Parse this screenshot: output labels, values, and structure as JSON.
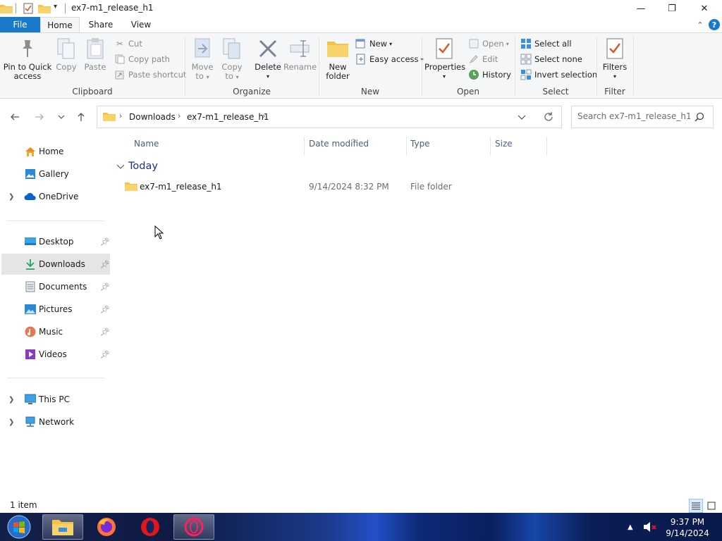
{
  "window": {
    "title": "ex7-m1_release_h1",
    "controls": {
      "minimize": "—",
      "restore": "❐",
      "close": "✕"
    }
  },
  "ribbon_tabs": [
    {
      "label": "File",
      "selected": false
    },
    {
      "label": "Home",
      "selected": true
    },
    {
      "label": "Share",
      "selected": false
    },
    {
      "label": "View",
      "selected": false
    }
  ],
  "ribbon": {
    "clipboard": {
      "label": "Clipboard",
      "pin": "Pin to Quick access",
      "pin_line1": "Pin to Quick",
      "pin_line2": "access",
      "copy": "Copy",
      "paste": "Paste",
      "cut": "Cut",
      "copy_path": "Copy path",
      "paste_shortcut": "Paste shortcut"
    },
    "organize": {
      "label": "Organize",
      "move_line1": "Move",
      "move_line2": "to",
      "copy_line1": "Copy",
      "copy_line2": "to",
      "delete": "Delete",
      "rename": "Rename"
    },
    "new": {
      "label": "New",
      "new_folder_line1": "New",
      "new_folder_line2": "folder",
      "new_item": "New",
      "easy_access": "Easy access"
    },
    "open": {
      "label": "Open",
      "properties": "Properties",
      "open": "Open",
      "edit": "Edit",
      "history": "History"
    },
    "select": {
      "label": "Select",
      "select_all": "Select all",
      "select_none": "Select none",
      "invert_selection": "Invert selection"
    },
    "filter": {
      "label": "Filter",
      "filters": "Filters"
    }
  },
  "address_bar": {
    "crumbs": [
      "Downloads",
      "ex7-m1_release_h1"
    ]
  },
  "search": {
    "placeholder": "Search ex7-m1_release_h1"
  },
  "nav_pane": {
    "home": "Home",
    "gallery": "Gallery",
    "onedrive": "OneDrive",
    "desktop": "Desktop",
    "downloads": "Downloads",
    "documents": "Documents",
    "pictures": "Pictures",
    "music": "Music",
    "videos": "Videos",
    "this_pc": "This PC",
    "network": "Network"
  },
  "columns": {
    "name": "Name",
    "date_modified": "Date modified",
    "type": "Type",
    "size": "Size"
  },
  "groups": [
    {
      "label": "Today",
      "items": [
        {
          "name": "ex7-m1_release_h1",
          "date_modified": "9/14/2024 8:32 PM",
          "type": "File folder",
          "size": ""
        }
      ]
    }
  ],
  "status": {
    "item_count": "1 item"
  },
  "taskbar": {
    "apps": [
      "file-explorer",
      "firefox",
      "opera",
      "opera-gx"
    ],
    "clock_time": "9:37 PM",
    "clock_date": "9/14/2024"
  },
  "colors": {
    "accent": "#1979ca",
    "folder": "#f5c242",
    "selected_nav": "#e5e5e5",
    "group_header": "#1e3287"
  }
}
